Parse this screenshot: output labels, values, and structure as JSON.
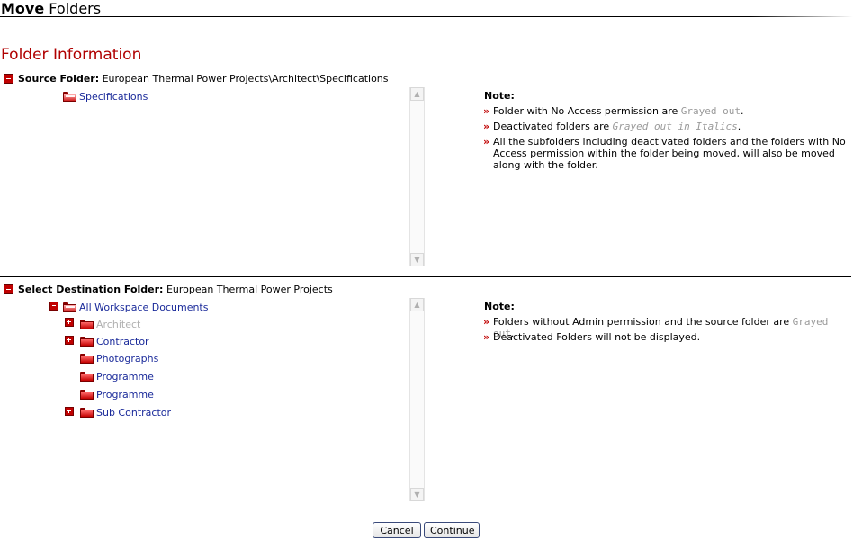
{
  "page": {
    "title_bold": "Move",
    "title_rest": " Folders",
    "section_heading": "Folder Information"
  },
  "source": {
    "label": "Source Folder:",
    "path": " European Thermal Power Projects\\Architect\\Specifications",
    "tree": [
      {
        "label": "Specifications"
      }
    ],
    "note": {
      "title": "Note:",
      "items": [
        {
          "pre": "Folder with No Access permission are ",
          "special": "Grayed out",
          "post": "."
        },
        {
          "pre": "Deactivated folders are ",
          "special": "Grayed out in Italics",
          "post": "."
        },
        {
          "pre": "All the subfolders including deactivated folders and the folders with No Access permission within the folder being moved, will also be moved along with the folder.",
          "special": "",
          "post": ""
        }
      ]
    }
  },
  "destination": {
    "label": "Select Destination Folder:",
    "path": " European Thermal Power Projects",
    "root": {
      "label": "All Workspace Documents"
    },
    "children": [
      {
        "label": "Architect",
        "grayed": true
      },
      {
        "label": "Contractor",
        "grayed": false
      },
      {
        "label": "Photographs",
        "grayed": false
      },
      {
        "label": "Programme",
        "grayed": false
      },
      {
        "label": "Programme",
        "grayed": false
      },
      {
        "label": "Sub Contractor",
        "grayed": false
      }
    ],
    "note": {
      "title": "Note:",
      "items": [
        {
          "pre": "Folders without Admin permission and the source folder are ",
          "special": "Grayed out",
          "post": "."
        },
        {
          "pre": "Deactivated Folders will not be displayed.",
          "special": "",
          "post": ""
        }
      ]
    }
  },
  "icons": {
    "bullet": "»",
    "scroll_up": "▲",
    "scroll_down": "▼"
  },
  "colors": {
    "heading": "#b00000",
    "link": "#1a2a9a",
    "grayed": "#b0b0b0",
    "bullet": "#c00000"
  },
  "buttons": {
    "cancel": "Cancel",
    "continue": "Continue"
  }
}
